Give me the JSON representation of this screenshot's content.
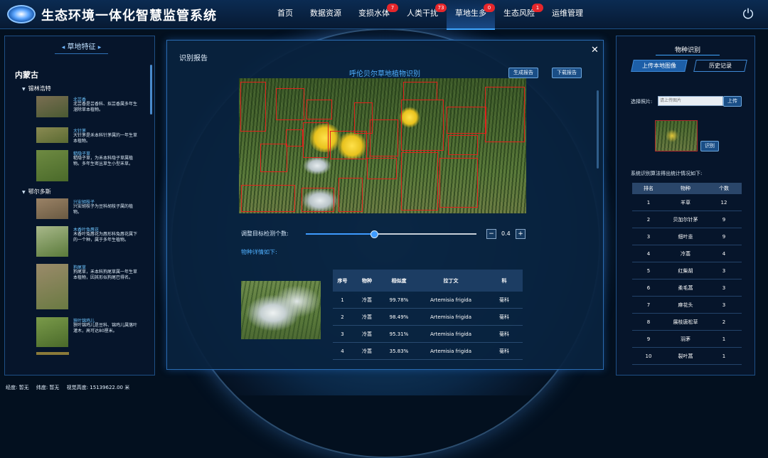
{
  "app": {
    "title": "生态环境一体化智慧监管系统",
    "nav": [
      {
        "label": "首页",
        "badge": ""
      },
      {
        "label": "数据资源",
        "badge": ""
      },
      {
        "label": "变损水体",
        "badge": "7"
      },
      {
        "label": "人类干扰",
        "badge": "73"
      },
      {
        "label": "草地生多",
        "badge": "0"
      },
      {
        "label": "生态风险",
        "badge": "1"
      },
      {
        "label": "运维管理",
        "badge": ""
      }
    ],
    "active_nav": "草地生多"
  },
  "left_panel": {
    "header": "草地特征",
    "region": "内蒙古",
    "groups": [
      {
        "name": "锡林浩特",
        "plants": [
          {
            "name": "北芸香",
            "desc": "北芸香是芸香科、拟芸香属多年生溜除草本植物。"
          },
          {
            "name": "大针茅",
            "desc": "大针茅是禾本科针茅属的一年生草本植物。"
          },
          {
            "name": "糙隐子草",
            "desc": "糙隐子草，为禾本科隐子草属植物。多年生密丛草生小型禾草。"
          }
        ]
      },
      {
        "name": "鄂尔多斯",
        "plants": [
          {
            "name": "兴安胡枝子",
            "desc": "兴安胡枝子为豆科胡枝子属的植物。"
          },
          {
            "name": "木香叶兔唇花",
            "desc": "木香叶兔唇花为唇形科兔唇花属下的一个种，属于多年生植物。"
          },
          {
            "name": "狗尾草",
            "desc": "狗尾草，禾本科狗尾草属一年生草本植物，因其形似狗尾巴得名。"
          },
          {
            "name": "狭叶锦鸡儿",
            "desc": "狭叶锦鸡儿是豆科、锦鸡儿属落叶灌木，高可达80厘米。"
          }
        ]
      }
    ]
  },
  "dialog": {
    "title": "识别报告",
    "photo_title": "呼伦贝尔草地植物识别",
    "generate_button": "生成报告",
    "download_button": "下载报告",
    "slider_label": "调整目标检测个数:",
    "slider_value": 0.4,
    "slider_value_text": "0.4",
    "minus": "−",
    "plus": "+",
    "detail_label": "物种详情如下:",
    "table_headers": [
      "序号",
      "物种",
      "相似度",
      "拉丁文",
      "科"
    ],
    "table_rows": [
      [
        "1",
        "冷蒿",
        "99.78%",
        "Artemisia frigida",
        "菊科"
      ],
      [
        "2",
        "冷蒿",
        "98.49%",
        "Artemisia frigida",
        "菊科"
      ],
      [
        "3",
        "冷蒿",
        "95.31%",
        "Artemisia frigida",
        "菊科"
      ],
      [
        "4",
        "冷蒿",
        "35.83%",
        "Artemisia frigida",
        "菊科"
      ]
    ]
  },
  "right_panel": {
    "header": "物种识别",
    "tab_upload": "上传本地图像",
    "tab_history": "历史记录",
    "choose_label": "选择照片:",
    "file_placeholder": "请上传图片",
    "upload_button": "上传",
    "identify_button": "识别",
    "stats_label": "系统识别算法得出统计情况如下:",
    "table_headers": [
      "排名",
      "物种",
      "个数"
    ],
    "table_rows": [
      [
        "1",
        "羊草",
        "12"
      ],
      [
        "2",
        "贝加尔针茅",
        "9"
      ],
      [
        "3",
        "细叶韭",
        "9"
      ],
      [
        "4",
        "冷蒿",
        "4"
      ],
      [
        "5",
        "红柴胡",
        "3"
      ],
      [
        "6",
        "柔毛蒿",
        "3"
      ],
      [
        "7",
        "麻花头",
        "3"
      ],
      [
        "8",
        "展枝唐松草",
        "2"
      ],
      [
        "9",
        "羽茅",
        "1"
      ],
      [
        "10",
        "裂叶蒿",
        "1"
      ]
    ]
  },
  "status_bar": {
    "longitude": "经度: 暂无",
    "latitude": "纬度: 暂无",
    "view_height": "视觉高度: 15139622.00 米"
  },
  "icons": {
    "power": "power-icon",
    "close": "close-icon",
    "logo": "logo-icon"
  },
  "colors": {
    "accent": "#3e9bff",
    "badge": "#e5262b",
    "detection_box": "#e0221c"
  }
}
